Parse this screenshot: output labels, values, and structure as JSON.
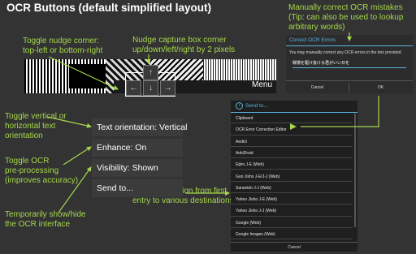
{
  "title": "OCR Buttons (default simplified layout)",
  "notes": {
    "nudge_toggle": [
      "Toggle nudge corner:",
      "top-left or bottom-right"
    ],
    "nudge_capture": [
      "Nudge capture box corner",
      "up/down/left/right by 2 pixels"
    ],
    "manual_correct": [
      "Manually correct OCR mistakes",
      "(Tip: can also be used to lookup",
      "arbitrary words)"
    ],
    "toggle_orientation": [
      "Toggle vertical or",
      "horizontal text",
      "orientation"
    ],
    "toggle_ocr": [
      "Toggle OCR",
      "pre-processing",
      "(improves accuracy)"
    ],
    "temp_hide": [
      "Temporarily show/hide",
      "the OCR interface"
    ],
    "send_expression": [
      "Send expression from first",
      "entry to various destinations"
    ]
  },
  "menu_label": "Menu",
  "nudge_buttons": {
    "up": "↑",
    "left": "←",
    "down": "↓",
    "right": "→"
  },
  "popup_menu": [
    "Text orientation: Vertical",
    "Enhance: On",
    "Visibility: Shown",
    "Send to..."
  ],
  "dialog": {
    "title": "Correct OCR Errors",
    "message": "You may manually correct any OCR errors in the box provided.",
    "input_value": "戦場を駆け抜ける君がいい日を",
    "cancel": "Cancel",
    "ok": "OK"
  },
  "send_list": {
    "header": "Send to...",
    "items": [
      "Clipboard",
      "OCR Error Correction Editor",
      "Aedict",
      "AnkiDroid",
      "Eijiro J-E (Web)",
      "Goo Jisho J-E/J-J (Web)",
      "Sanseido J-J (Web)",
      "Yahoo Jisho J-E (Web)",
      "Yahoo Jisho J-J (Web)",
      "Google (Web)",
      "Google Images (Web)"
    ],
    "cancel": "Cancel"
  },
  "colors": {
    "accent_green": "#a5d84a",
    "accent_blue": "#58b3e0",
    "background": "#333333"
  }
}
